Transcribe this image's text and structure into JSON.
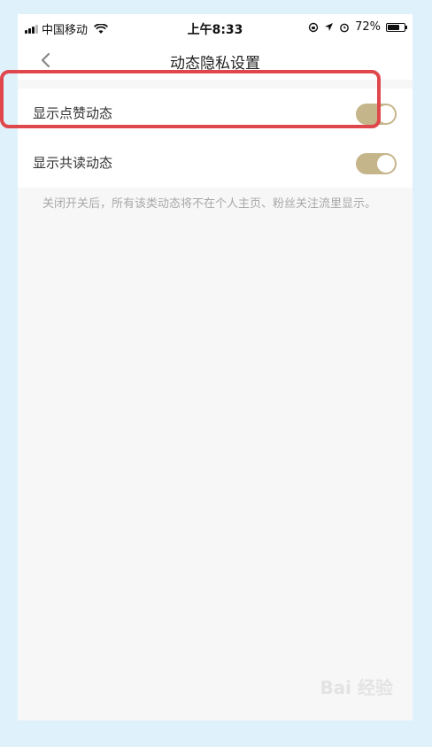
{
  "status_bar": {
    "carrier": "中国移动",
    "time": "上午8:33",
    "battery": "72%",
    "battery_level": 0.72
  },
  "nav": {
    "title": "动态隐私设置",
    "back_icon": "chevron-left-icon"
  },
  "settings": [
    {
      "label": "显示点赞动态",
      "enabled": true
    },
    {
      "label": "显示共读动态",
      "enabled": true
    }
  ],
  "note": "关闭开关后，所有该类动态将不在个人主页、粉丝关注流里显示。",
  "watermark": "Bai 经验",
  "colors": {
    "toggle_on": "#c5b58a",
    "highlight": "#e0474c",
    "page_bg": "#f7f7f7",
    "frame_bg": "#dff1fb"
  }
}
